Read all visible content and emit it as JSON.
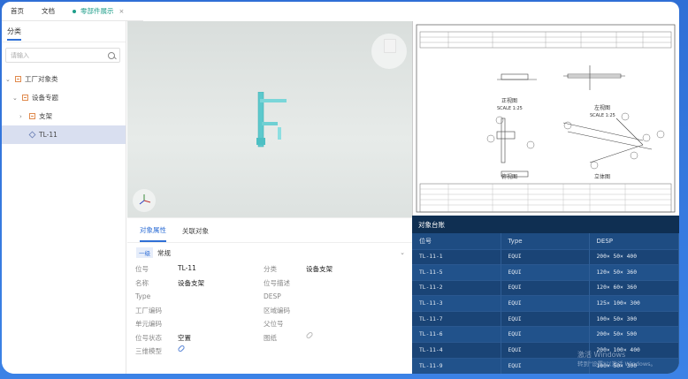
{
  "tabs": [
    {
      "label": "首页"
    },
    {
      "label": "文档"
    },
    {
      "label": "零部件展示",
      "active": true
    }
  ],
  "sidebar": {
    "title": "分类",
    "search_placeholder": "请输入",
    "tree": [
      {
        "label": "工厂对象类",
        "depth": 0,
        "expanded": true,
        "icon": "folder-icon"
      },
      {
        "label": "设备专题",
        "depth": 1,
        "expanded": true,
        "icon": "folder-icon"
      },
      {
        "label": "支架",
        "depth": 2,
        "expanded": false,
        "icon": "folder-icon"
      },
      {
        "label": "TL-11",
        "depth": 2,
        "selected": true,
        "icon": "cube-icon"
      }
    ]
  },
  "props": {
    "tabs": [
      "对象属性",
      "关联对象"
    ],
    "group_badge": "一级",
    "group_label": "常规",
    "rows": [
      {
        "l1": "位号",
        "v1": "TL-11",
        "l2": "分类",
        "v2": "设备支架"
      },
      {
        "l1": "名称",
        "v1": "设备支架",
        "l2": "位号描述",
        "v2": ""
      },
      {
        "l1": "Type",
        "v1": "",
        "l2": "DESP",
        "v2": ""
      },
      {
        "l1": "工厂编码",
        "v1": "",
        "l2": "区域编码",
        "v2": ""
      },
      {
        "l1": "单元编码",
        "v1": "",
        "l2": "父位号",
        "v2": ""
      },
      {
        "l1": "位号状态",
        "v1": "空置",
        "l2": "图纸",
        "v2": ""
      },
      {
        "l1": "三维模型",
        "v1": "",
        "l2": "",
        "v2": ""
      }
    ]
  },
  "table": {
    "title": "对象台账",
    "headers": [
      "位号",
      "Type",
      "DESP"
    ],
    "rows": [
      [
        "TL-11-1",
        "EQUI",
        "200× 50× 400"
      ],
      [
        "TL-11-5",
        "EQUI",
        "120× 50× 360"
      ],
      [
        "TL-11-2",
        "EQUI",
        "120× 60× 360"
      ],
      [
        "TL-11-3",
        "EQUI",
        "125× 100× 300"
      ],
      [
        "TL-11-7",
        "EQUI",
        "100× 50× 300"
      ],
      [
        "TL-11-6",
        "EQUI",
        "200× 50× 500"
      ],
      [
        "TL-11-4",
        "EQUI",
        "200× 100× 400"
      ],
      [
        "TL-11-9",
        "EQUI",
        "100× 50× 300"
      ]
    ]
  },
  "drawing": {
    "views": [
      "正视图",
      "左视图",
      "俯视图",
      "立体图"
    ],
    "scale": "SCALE 1:25"
  },
  "watermark": {
    "line1": "激活 Windows",
    "line2": "转到\"设置\"以激活 Windows。"
  }
}
